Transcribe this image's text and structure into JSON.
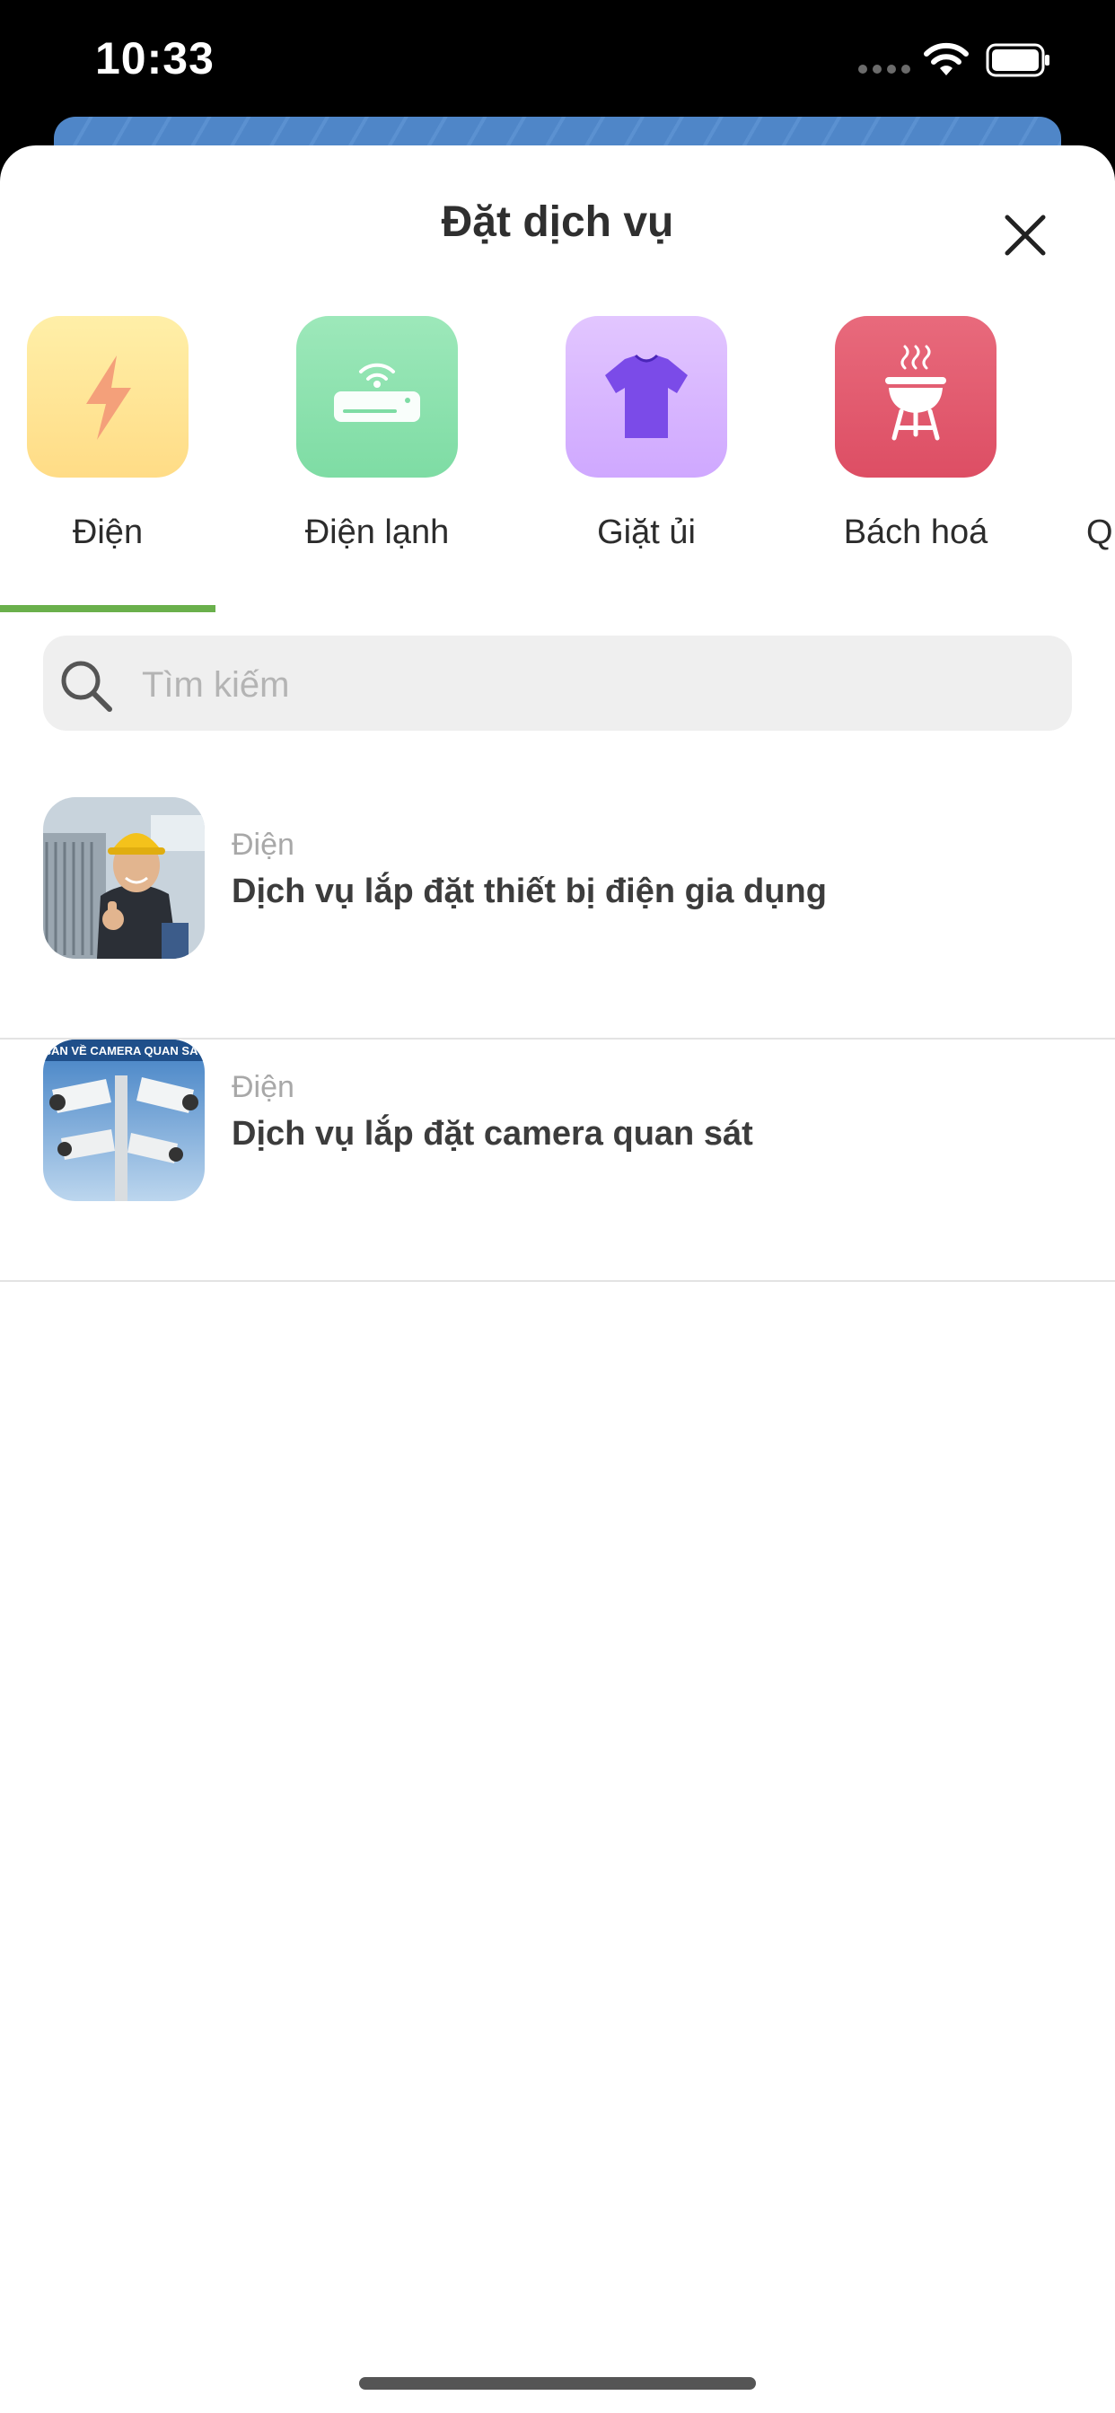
{
  "status_bar": {
    "time": "10:33"
  },
  "sheet": {
    "title": "Đặt dịch vụ"
  },
  "categories": [
    {
      "label": "Điện",
      "icon": "lightning-icon",
      "color": "#FFE08A"
    },
    {
      "label": "Điện lạnh",
      "icon": "air-conditioner-icon",
      "color": "#8EE3B0"
    },
    {
      "label": "Giặt ủi",
      "icon": "tshirt-icon",
      "color": "#D5B4FF"
    },
    {
      "label": "Bách hoá",
      "icon": "grill-icon",
      "color": "#E2566C"
    },
    {
      "label": "Q",
      "icon": "",
      "color": ""
    }
  ],
  "selected_category_index": 0,
  "accent_color": "#6AB04C",
  "search": {
    "placeholder": "Tìm kiếm",
    "value": ""
  },
  "services": [
    {
      "category": "Điện",
      "title": "Dịch vụ lắp đặt thiết bị điện gia dụng",
      "thumb": "electrician-photo"
    },
    {
      "category": "Điện",
      "title": "Dịch vụ lắp đặt camera quan sát",
      "thumb": "cctv-camera-photo",
      "thumb_caption": "BÁN VỀ CAMERA QUAN SÁT"
    }
  ]
}
